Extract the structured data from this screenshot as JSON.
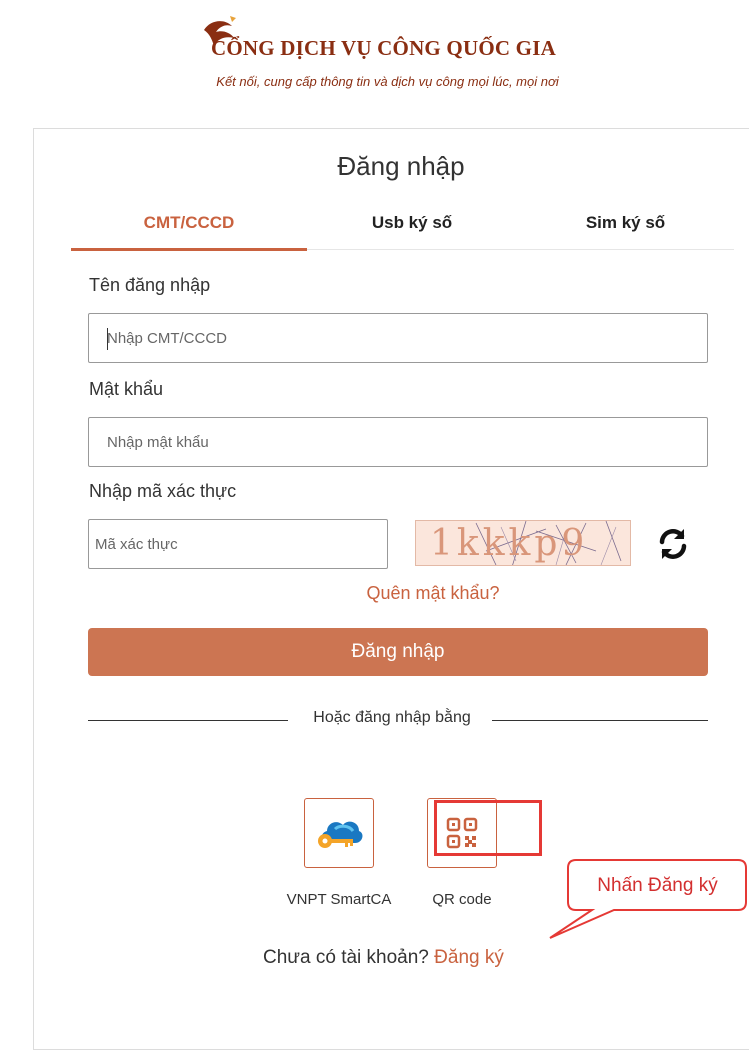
{
  "header": {
    "title": "CỔNG DỊCH VỤ CÔNG QUỐC GIA",
    "subtitle": "Kết nối, cung cấp thông tin và dịch vụ công mọi lúc, mọi nơi"
  },
  "login": {
    "title": "Đăng nhập",
    "tabs": [
      {
        "label": "CMT/CCCD",
        "active": true
      },
      {
        "label": "Usb ký số",
        "active": false
      },
      {
        "label": "Sim ký số",
        "active": false
      }
    ],
    "username_label": "Tên đăng nhập",
    "username_placeholder": "Nhập CMT/CCCD",
    "password_label": "Mật khẩu",
    "password_placeholder": "Nhập mật khẩu",
    "captcha_label": "Nhập mã xác thực",
    "captcha_placeholder": "Mã xác thực",
    "captcha_text": "1kkkp9",
    "forgot_password": "Quên mật khẩu?",
    "submit_label": "Đăng nhập",
    "alt_login_text": "Hoặc đăng nhập bằng",
    "methods": [
      {
        "label": "VNPT SmartCA",
        "icon": "cloud-key-icon"
      },
      {
        "label": "QR code",
        "icon": "qr-code-icon"
      }
    ],
    "no_account_text": "Chưa có tài khoản?",
    "register_link": "Đăng ký"
  },
  "annotation": {
    "callout_text": "Nhấn Đăng ký",
    "highlight_color": "#e53935"
  },
  "colors": {
    "brand": "#c9623f",
    "button": "#cc7552",
    "title_text": "#8a2e12"
  }
}
